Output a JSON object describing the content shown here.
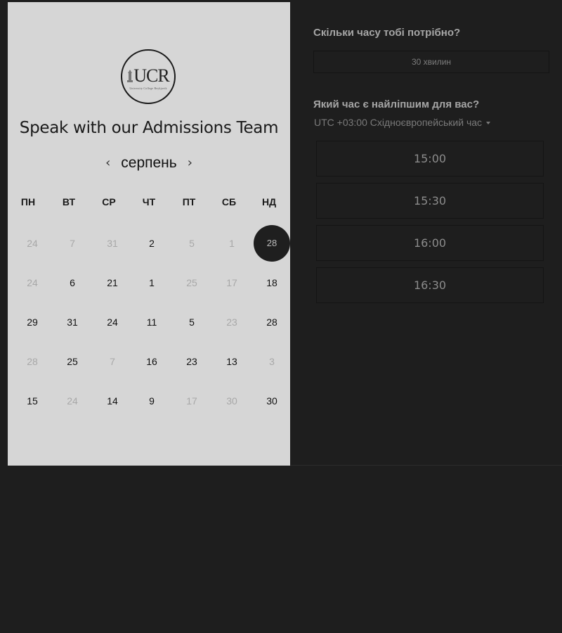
{
  "logo": {
    "text": "UCR",
    "subtext": "University College Reykjavik"
  },
  "title": "Speak with our Admissions Team",
  "calendar": {
    "month": "серпень",
    "prev_arrow": "‹",
    "next_arrow": "›",
    "weekdays": [
      "ПН",
      "ВТ",
      "СР",
      "ЧТ",
      "ПТ",
      "СБ",
      "НД"
    ],
    "weeks": [
      [
        "24",
        "7",
        "31",
        "2",
        "5",
        "1",
        "28"
      ],
      [
        "24",
        "6",
        "21",
        "1",
        "25",
        "17",
        "18"
      ],
      [
        "29",
        "31",
        "24",
        "11",
        "5",
        "23",
        "28"
      ],
      [
        "28",
        "25",
        "7",
        "16",
        "23",
        "13",
        "3"
      ],
      [
        "15",
        "24",
        "14",
        "9",
        "17",
        "30",
        "30"
      ]
    ],
    "disabled": [
      [
        true,
        true,
        true,
        false,
        true,
        true,
        false
      ],
      [
        true,
        false,
        false,
        false,
        true,
        true,
        false
      ],
      [
        false,
        false,
        false,
        false,
        false,
        true,
        false
      ],
      [
        true,
        false,
        true,
        false,
        false,
        false,
        true
      ],
      [
        false,
        true,
        false,
        false,
        true,
        true,
        false
      ]
    ],
    "selected": [
      0,
      6
    ]
  },
  "duration": {
    "label": "Скільки часу тобі потрібно?",
    "value": "30 хвилин"
  },
  "time": {
    "label": "Який час є найліпшим для вас?",
    "timezone": "UTC +03:00 Східноєвропейський час",
    "slots": [
      "15:00",
      "15:30",
      "16:00",
      "16:30"
    ]
  },
  "colors": {
    "page_background": "#1e1e1e",
    "calendar_background": "#d6d6d6",
    "selected_day": "#1f1f1f"
  }
}
